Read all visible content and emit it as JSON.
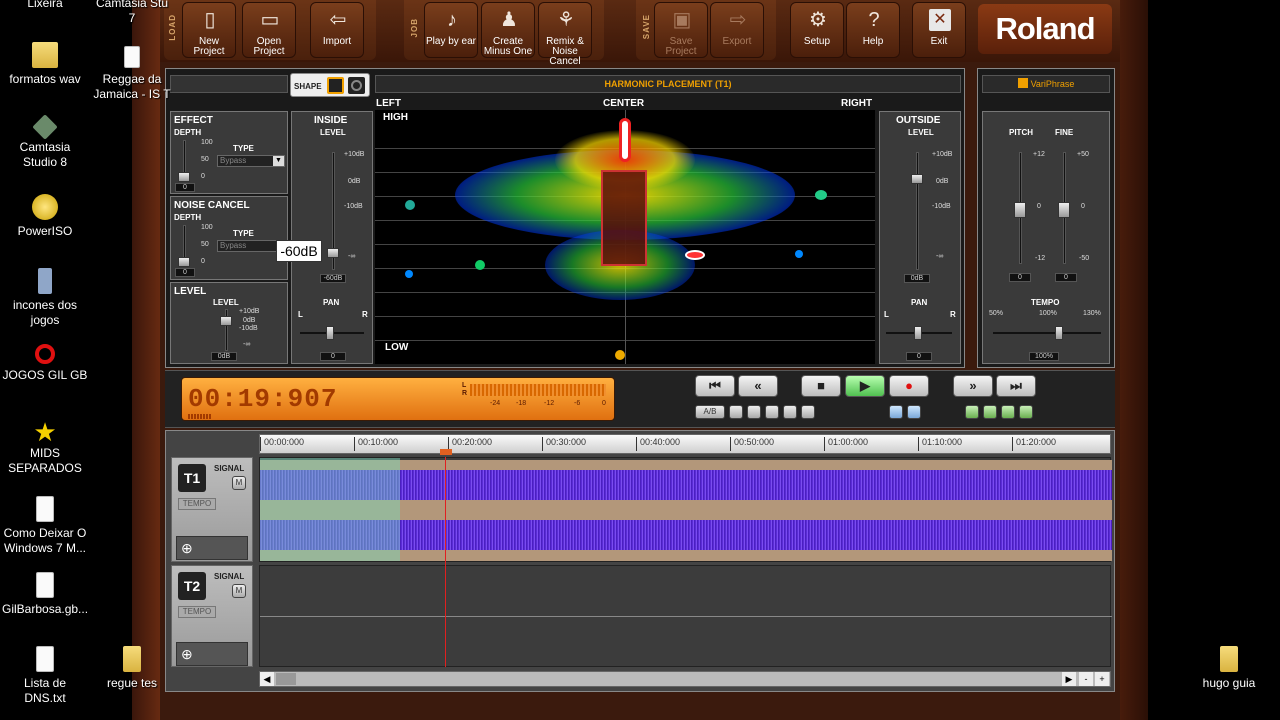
{
  "desktop": {
    "left_icons": [
      {
        "label": "Lixeira",
        "icon": "recycle-bin-icon"
      },
      {
        "label": "formatos wav",
        "icon": "folder-icon"
      },
      {
        "label": "Camtasia Studio 8",
        "icon": "camtasia-icon"
      },
      {
        "label": "PowerISO",
        "icon": "poweriso-icon"
      },
      {
        "label": "incones dos jogos",
        "icon": "file-icon"
      },
      {
        "label": "JOGOS GIL GB",
        "icon": "no-entry-icon"
      },
      {
        "label": "MIDS SEPARADOS",
        "icon": "star-icon"
      },
      {
        "label": "Como Deixar O Windows 7 M...",
        "icon": "document-icon"
      },
      {
        "label": "GilBarbosa.gb...",
        "icon": "document-icon"
      },
      {
        "label": "Lista de DNS.txt",
        "icon": "text-file-icon"
      }
    ],
    "col2_icons": [
      {
        "label": "Camtasia Stu 7"
      },
      {
        "label": "Reggae da Jamaica - IS T"
      },
      {
        "label": "regue tes"
      }
    ],
    "right_icons": [
      {
        "label": "hugo guia",
        "icon": "folder-icon"
      }
    ]
  },
  "toolbar": {
    "groups": [
      "LOAD",
      "JOB",
      "SAVE"
    ],
    "buttons": [
      {
        "label": "New\nProject",
        "icon": "new-project-icon"
      },
      {
        "label": "Open\nProject",
        "icon": "open-project-icon"
      },
      {
        "label": "Import",
        "icon": "import-icon"
      },
      {
        "label": "Play by ear",
        "icon": "ear-icon"
      },
      {
        "label": "Create\nMinus One",
        "icon": "minus-one-icon"
      },
      {
        "label": "Remix &\nNoise Cancel",
        "icon": "broom-icon"
      },
      {
        "label": "Save\nProject",
        "icon": "save-icon",
        "disabled": true
      },
      {
        "label": "Export",
        "icon": "export-icon",
        "disabled": true
      },
      {
        "label": "Setup",
        "icon": "gear-icon"
      },
      {
        "label": "Help",
        "icon": "help-icon"
      },
      {
        "label": "Exit",
        "icon": "close-icon"
      }
    ],
    "brand": "Roland"
  },
  "shape": {
    "label": "SHAPE"
  },
  "harmonic": {
    "title": "HARMONIC PLACEMENT (T1)",
    "left": "LEFT",
    "center": "CENTER",
    "right": "RIGHT",
    "high": "HIGH",
    "low": "LOW"
  },
  "effect": {
    "title": "EFFECT",
    "depth": "DEPTH",
    "type_label": "TYPE",
    "type_value": "Bypass",
    "scale": [
      "100",
      "50",
      "0"
    ],
    "value": "0"
  },
  "noise": {
    "title": "NOISE CANCEL",
    "depth": "DEPTH",
    "type_label": "TYPE",
    "type_value": "Bypass",
    "scale": [
      "100",
      "50",
      "0"
    ],
    "value": "0"
  },
  "level": {
    "title": "LEVEL",
    "sub": "LEVEL",
    "scale": [
      "+10dB",
      "0dB",
      "-10dB",
      "-∞"
    ],
    "value": "0dB"
  },
  "inside": {
    "title": "INSIDE",
    "sub": "LEVEL",
    "scale": [
      "+10dB",
      "0dB",
      "-10dB",
      "-∞"
    ],
    "tooltip": "-60dB",
    "value": "-60dB",
    "pan": "PAN",
    "l": "L",
    "r": "R",
    "pan_value": "0"
  },
  "outside": {
    "title": "OUTSIDE",
    "sub": "LEVEL",
    "scale": [
      "+10dB",
      "0dB",
      "-10dB",
      "-∞"
    ],
    "value": "0dB",
    "pan": "PAN",
    "l": "L",
    "r": "R",
    "pan_value": "0"
  },
  "variphrase": {
    "title": "VariPhrase",
    "pitch": "PITCH",
    "fine": "FINE",
    "pitch_scale": [
      "+12",
      "0",
      "-12"
    ],
    "fine_scale": [
      "+50",
      "0",
      "-50"
    ],
    "pitch_value": "0",
    "fine_value": "0",
    "tempo": "TEMPO",
    "tempo_scale": [
      "50%",
      "100%",
      "130%"
    ],
    "tempo_value": "100%"
  },
  "transport": {
    "time": "00:19:907",
    "meter_l": "L",
    "meter_r": "R",
    "meter_scale": [
      "-24",
      "-18",
      "-12",
      "-6",
      "0"
    ],
    "ab": "A/B"
  },
  "timeline": {
    "ticks": [
      "00:00:000",
      "00:10:000",
      "00:20:000",
      "00:30:000",
      "00:40:000",
      "00:50:000",
      "01:00:000",
      "01:10:000",
      "01:20:000"
    ],
    "tracks": [
      {
        "id": "T1",
        "signal": "SIGNAL",
        "m": "M",
        "tempo": "TEMPO"
      },
      {
        "id": "T2",
        "signal": "SIGNAL",
        "m": "M",
        "tempo": "TEMPO"
      }
    ],
    "playhead_fraction": 0.22
  },
  "colors": {
    "accent": "#e07010",
    "brand": "#8a3a14",
    "wave": "#5a2bd6"
  }
}
